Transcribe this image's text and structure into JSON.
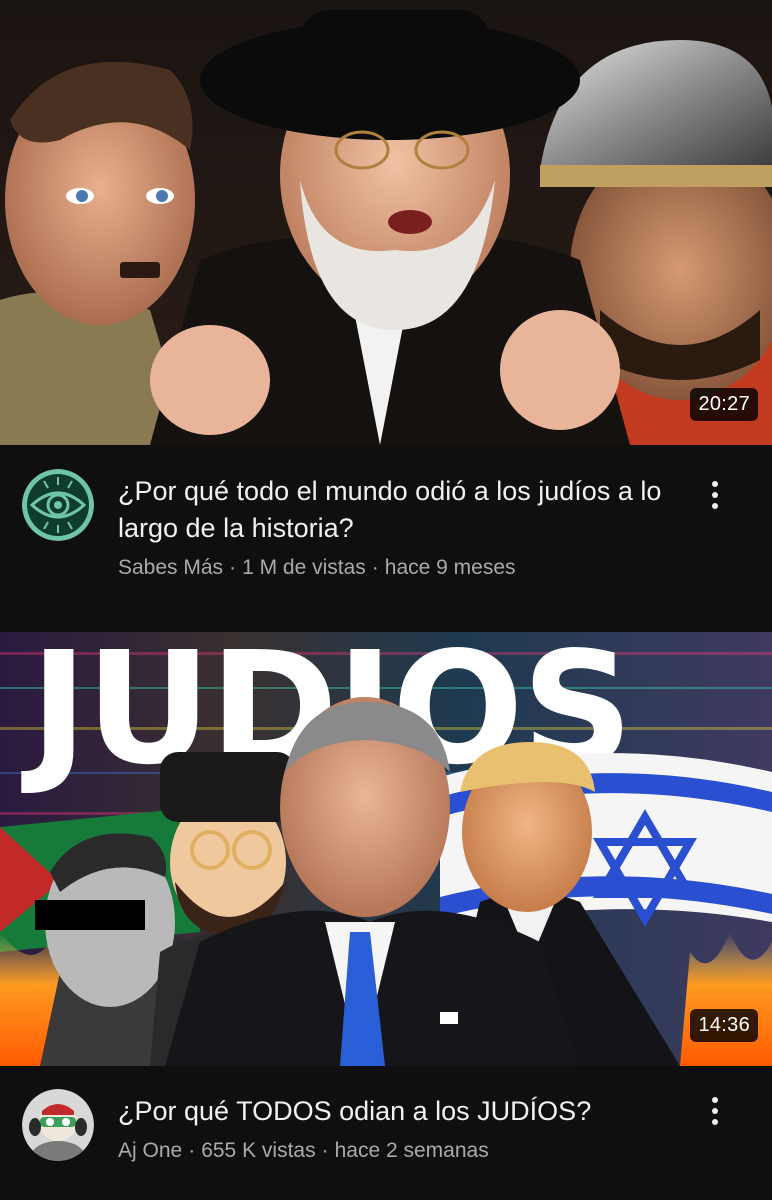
{
  "videos": [
    {
      "title": "¿Por qué todo el mundo odió a los judíos a lo largo de la historia?",
      "channel": "Sabes Más",
      "views": "1 M de vistas",
      "age": "hace 9 meses",
      "duration": "20:27",
      "avatar_icon": "eye-logo-icon",
      "more_icon": "more-vert-icon"
    },
    {
      "title": "¿Por qué TODOS odian a los JUDÍOS?",
      "channel": "Aj One",
      "views": "655 K vistas",
      "age": "hace 2 semanas",
      "duration": "14:36",
      "thumbnail_text": "JUDIOS",
      "avatar_icon": "cartoon-avatar-icon",
      "more_icon": "more-vert-icon"
    }
  ],
  "separator": "·",
  "colors": {
    "background": "#0f0f0f",
    "title": "#f1f1f1",
    "meta": "#aaaaaa"
  }
}
